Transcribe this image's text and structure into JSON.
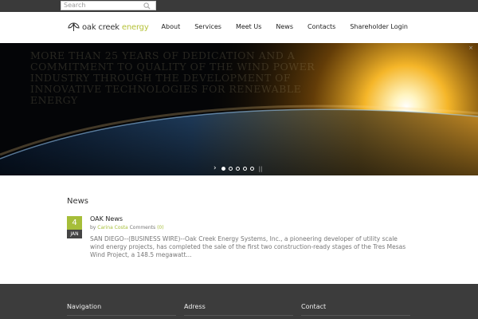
{
  "search": {
    "placeholder": "Search"
  },
  "brand": {
    "name_main": "oak creek",
    "name_accent": "energy"
  },
  "nav": {
    "items": [
      "About",
      "Services",
      "Meet Us",
      "News",
      "Contacts",
      "Shareholder Login"
    ]
  },
  "hero": {
    "overlay_text": "MORE THAN 25 YEARS OF DEDICATION AND A COMMITMENT TO QUALITY OF THE WIND POWER INDUSTRY THROUGH THE DEVELOPMENT OF INNOVATIVE TECHNOLOGIES FOR RENEWABLE ENERGY",
    "slides": 5,
    "active_slide": 1,
    "prev_label": "›",
    "pause_label": "||",
    "close_label": "×"
  },
  "news": {
    "section_title": "News",
    "post": {
      "day": "4",
      "month": "JAN",
      "title": "OAK News",
      "by_label": "by",
      "author": "Carina Costa",
      "comments_label": "Comments",
      "comments_count": "(0)",
      "excerpt": "SAN DIEGO--(BUSINESS WIRE)--Oak Creek Energy Systems, Inc., a pioneering developer of utility scale wind energy projects, has completed the sale of the first two construction-ready stages of the Tres Mesas Wind Project, a 148.5 megawatt..."
    }
  },
  "footer": {
    "col1": "Navigation",
    "col2": "Adress",
    "col3": "Contact"
  },
  "colors": {
    "accent": "#a6be39",
    "dark": "#3c3c3c"
  }
}
